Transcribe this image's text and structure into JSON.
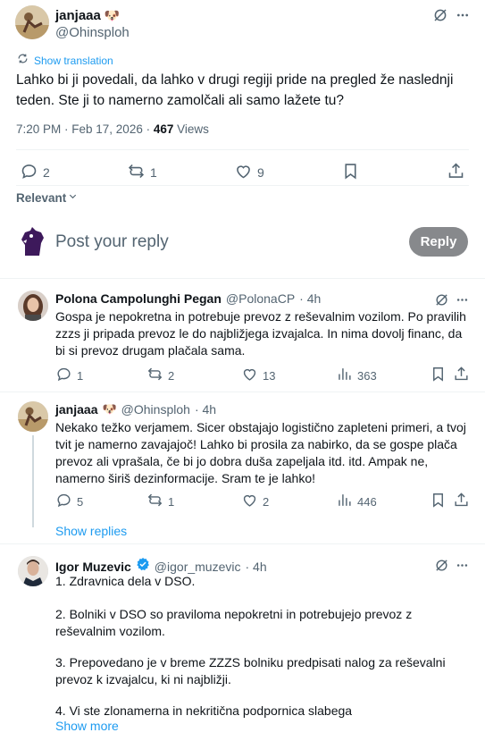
{
  "main_tweet": {
    "author_name": "janjaaa",
    "author_emoji": "🐶",
    "author_handle": "@Ohinsploh",
    "translate_label": "Show translation",
    "text": "Lahko bi ji povedali, da lahko v drugi regiji pride na pregled že naslednji teden. Ste ji to namerno zamolčali ali samo lažete tu?",
    "timestamp": "7:20 PM · Feb 17, 2026 · ",
    "views_count": "467",
    "views_label": " Views",
    "replies": "2",
    "reposts": "1",
    "likes": "9"
  },
  "sort_label": "Relevant",
  "composer": {
    "placeholder": "Post your reply",
    "reply_button": "Reply"
  },
  "replies": [
    {
      "name": "Polona Campolunghi Pegan",
      "handle": "@PolonaCP",
      "time": "· 4h",
      "text": "Gospa je nepokretna in potrebuje prevoz z reševalnim vozilom. Po pravilih zzzs ji pripada prevoz le do najbližjega izvajalca. In nima dovolj financ, da bi si prevoz drugam plačala sama.",
      "replies": "1",
      "reposts": "2",
      "likes": "13",
      "views": "363"
    },
    {
      "name": "janjaaa",
      "emoji": "🐶",
      "handle": "@Ohinsploh",
      "time": "· 4h",
      "text": "Nekako težko verjamem. Sicer obstajajo logistično zapleteni primeri, a tvoj tvit je namerno zavajajoč! Lahko bi prosila za nabirko, da se gospe plača prevoz ali vprašala, če bi jo dobra duša zapeljala itd. itd. Ampak ne, namerno širiš dezinformacije. Sram  te je lahko!",
      "replies": "5",
      "reposts": "1",
      "likes": "2",
      "views": "446",
      "show_replies": "Show replies"
    },
    {
      "name": "Igor Muzevic",
      "handle": "@igor_muzevic",
      "time": "· 4h",
      "paragraphs": [
        "1. Zdravnica dela v DSO.",
        "2. Bolniki v DSO so praviloma nepokretni in potrebujejo prevoz z reševalnim vozilom.",
        "3. Prepovedano je v breme ZZZS bolniku predpisati nalog za reševalni prevoz k izvajalcu, ki ni najbližji.",
        "4. Vi ste zlonamerna in nekritična podpornica slabega"
      ],
      "show_more": "Show more"
    }
  ],
  "colors": {
    "accent": "#1d9bf0",
    "muted": "#536471",
    "divider": "#eff3f4",
    "reply_button_bg": "#87898c"
  },
  "icons": {
    "grok": "grok-icon",
    "more": "more-icon",
    "reply": "reply-icon",
    "repost": "repost-icon",
    "like": "like-icon",
    "bookmark": "bookmark-icon",
    "share": "share-icon",
    "views": "views-icon",
    "translate": "translate-icon",
    "verified": "verified-badge-icon"
  }
}
